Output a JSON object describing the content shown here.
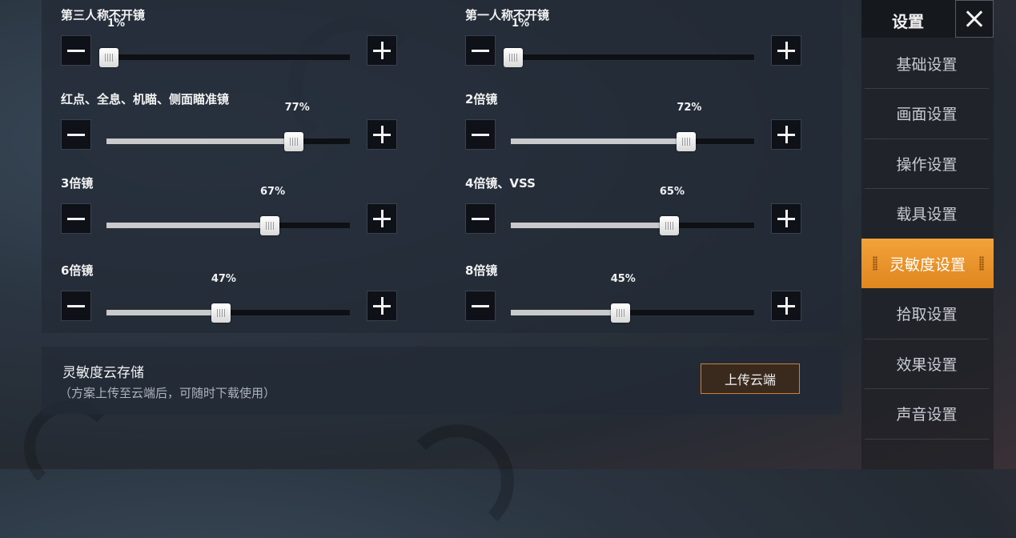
{
  "sliders": [
    {
      "label": "第三人称不开镜",
      "value": 1,
      "value_text": "1%"
    },
    {
      "label": "第一人称不开镜",
      "value": 1,
      "value_text": "1%"
    },
    {
      "label": "红点、全息、机瞄、侧面瞄准镜",
      "value": 77,
      "value_text": "77%"
    },
    {
      "label": "2倍镜",
      "value": 72,
      "value_text": "72%"
    },
    {
      "label": "3倍镜",
      "value": 67,
      "value_text": "67%"
    },
    {
      "label": "4倍镜、VSS",
      "value": 65,
      "value_text": "65%"
    },
    {
      "label": "6倍镜",
      "value": 47,
      "value_text": "47%"
    },
    {
      "label": "8倍镜",
      "value": 45,
      "value_text": "45%"
    }
  ],
  "cloud": {
    "title": "灵敏度云存储",
    "subtitle": "（方案上传至云端后，可随时下载使用）",
    "upload_label": "上传云端"
  },
  "sidebar": {
    "title": "设置",
    "items": [
      {
        "label": "基础设置",
        "active": false
      },
      {
        "label": "画面设置",
        "active": false
      },
      {
        "label": "操作设置",
        "active": false
      },
      {
        "label": "载具设置",
        "active": false
      },
      {
        "label": "灵敏度设置",
        "active": true
      },
      {
        "label": "拾取设置",
        "active": false
      },
      {
        "label": "效果设置",
        "active": false
      },
      {
        "label": "声音设置",
        "active": false
      }
    ]
  },
  "colors": {
    "accent": "#e8922a",
    "track_fill": "#c9cacc",
    "panel": "#232a36"
  }
}
